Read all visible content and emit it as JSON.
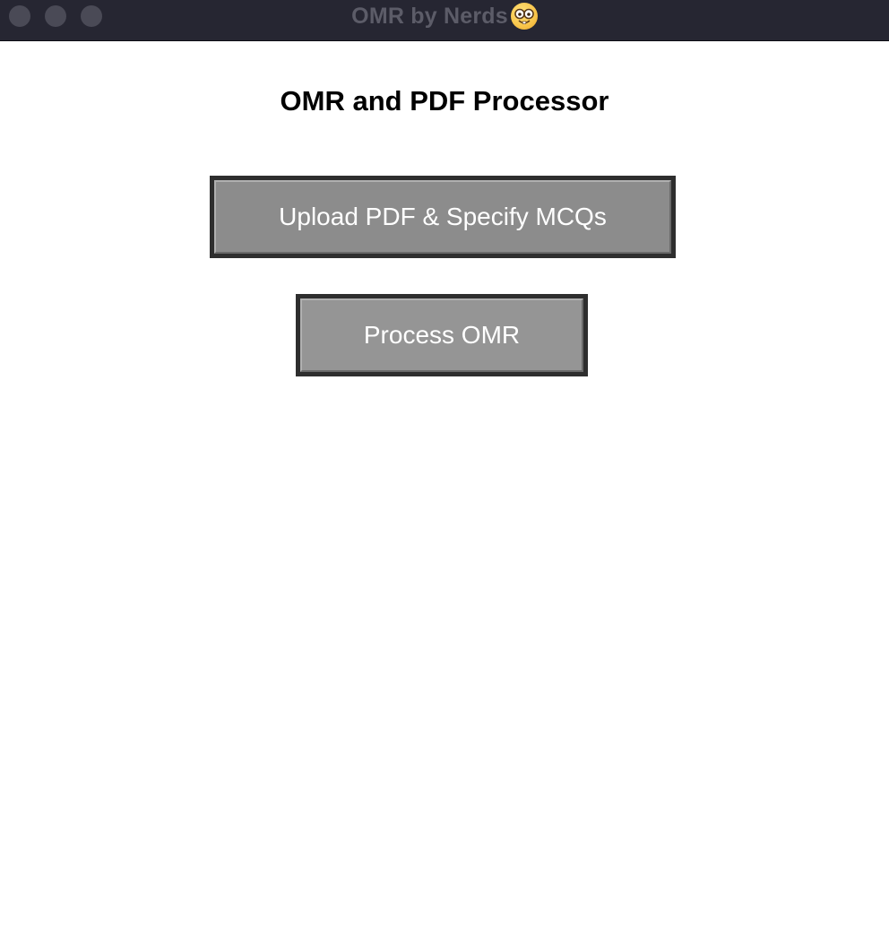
{
  "window": {
    "title": "OMR by Nerds",
    "title_icon": "nerd-face-icon"
  },
  "main": {
    "heading": "OMR and PDF Processor",
    "upload_button_label": "Upload PDF & Specify MCQs",
    "process_button_label": "Process OMR"
  },
  "colors": {
    "titlebar": "#262632",
    "button_border": "#2e2e2e",
    "button_fill": "#8c8c8c",
    "button_text": "#ffffff"
  }
}
